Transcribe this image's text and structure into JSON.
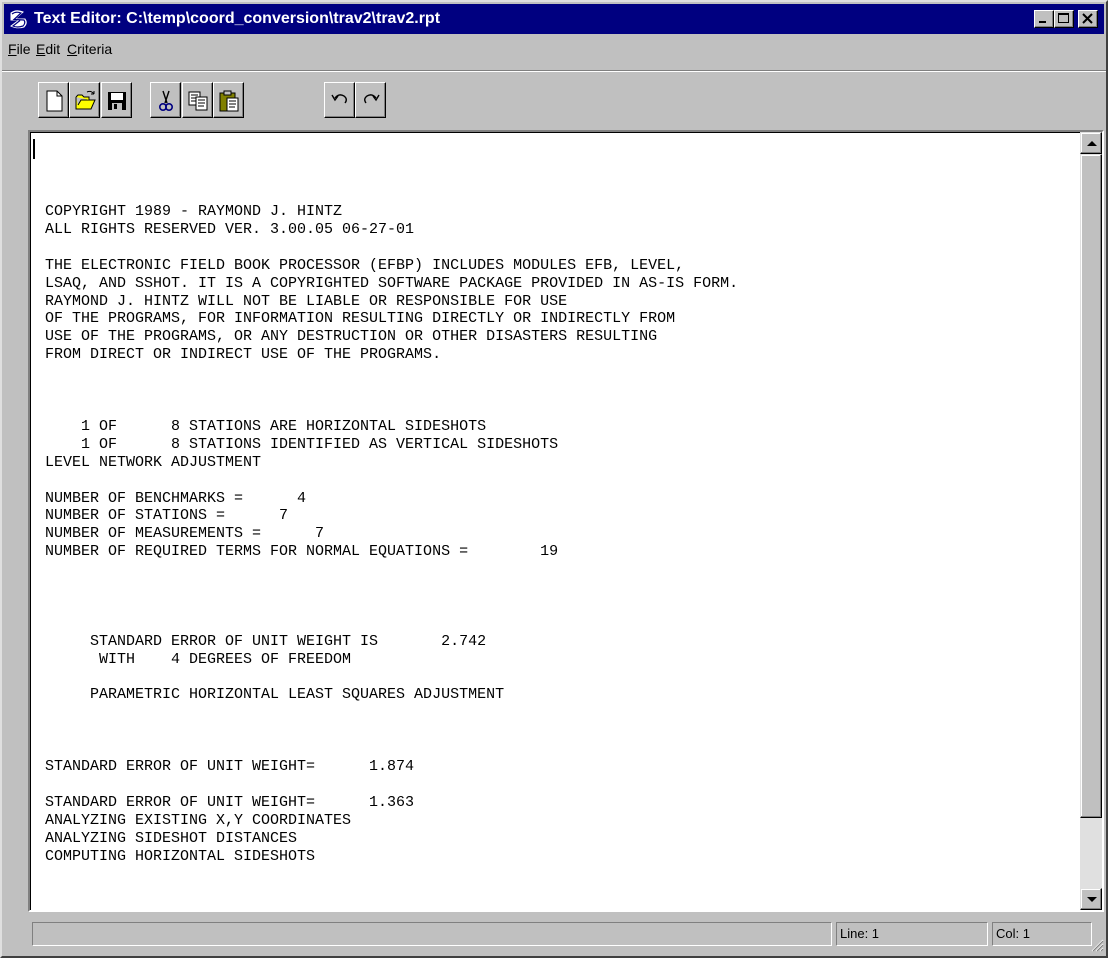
{
  "window": {
    "title": "Text Editor: C:\\temp\\coord_conversion\\trav2\\trav2.rpt"
  },
  "menu": {
    "items": [
      {
        "label": "File",
        "accel": "F",
        "rest": "ile"
      },
      {
        "label": "Edit",
        "accel": "E",
        "rest": "dit"
      },
      {
        "label": "Criteria",
        "accel": "C",
        "rest": "riteria"
      }
    ]
  },
  "toolbar": {
    "buttons": [
      {
        "name": "new-button",
        "icon": "new-document-icon"
      },
      {
        "name": "open-button",
        "icon": "open-folder-icon"
      },
      {
        "name": "save-button",
        "icon": "floppy-disk-icon"
      },
      {
        "name": "cut-button",
        "icon": "scissors-icon"
      },
      {
        "name": "copy-button",
        "icon": "copy-icon"
      },
      {
        "name": "paste-button",
        "icon": "clipboard-icon"
      },
      {
        "name": "undo-button",
        "icon": "undo-icon"
      },
      {
        "name": "redo-button",
        "icon": "redo-icon"
      }
    ]
  },
  "editor": {
    "lines": [
      "COPYRIGHT 1989 - RAYMOND J. HINTZ",
      "ALL RIGHTS RESERVED VER. 3.00.05 06-27-01",
      "",
      "THE ELECTRONIC FIELD BOOK PROCESSOR (EFBP) INCLUDES MODULES EFB, LEVEL,",
      "LSAQ, AND SSHOT. IT IS A COPYRIGHTED SOFTWARE PACKAGE PROVIDED IN AS-IS FORM.",
      "RAYMOND J. HINTZ WILL NOT BE LIABLE OR RESPONSIBLE FOR USE",
      "OF THE PROGRAMS, FOR INFORMATION RESULTING DIRECTLY OR INDIRECTLY FROM",
      "USE OF THE PROGRAMS, OR ANY DESTRUCTION OR OTHER DISASTERS RESULTING",
      "FROM DIRECT OR INDIRECT USE OF THE PROGRAMS.",
      "",
      "",
      "",
      "    1 OF      8 STATIONS ARE HORIZONTAL SIDESHOTS",
      "    1 OF      8 STATIONS IDENTIFIED AS VERTICAL SIDESHOTS",
      "LEVEL NETWORK ADJUSTMENT",
      "",
      "NUMBER OF BENCHMARKS =      4",
      "NUMBER OF STATIONS =      7",
      "NUMBER OF MEASUREMENTS =      7",
      "NUMBER OF REQUIRED TERMS FOR NORMAL EQUATIONS =        19",
      "",
      "",
      "",
      "",
      "     STANDARD ERROR OF UNIT WEIGHT IS       2.742",
      "      WITH    4 DEGREES OF FREEDOM",
      "",
      "     PARAMETRIC HORIZONTAL LEAST SQUARES ADJUSTMENT",
      "",
      "",
      "",
      "STANDARD ERROR OF UNIT WEIGHT=      1.874",
      "",
      "STANDARD ERROR OF UNIT WEIGHT=      1.363",
      "ANALYZING EXISTING X,Y COORDINATES",
      "ANALYZING SIDESHOT DISTANCES",
      "COMPUTING HORIZONTAL SIDESHOTS"
    ]
  },
  "status": {
    "message": "",
    "line": "Line: 1",
    "col": "Col: 1"
  }
}
